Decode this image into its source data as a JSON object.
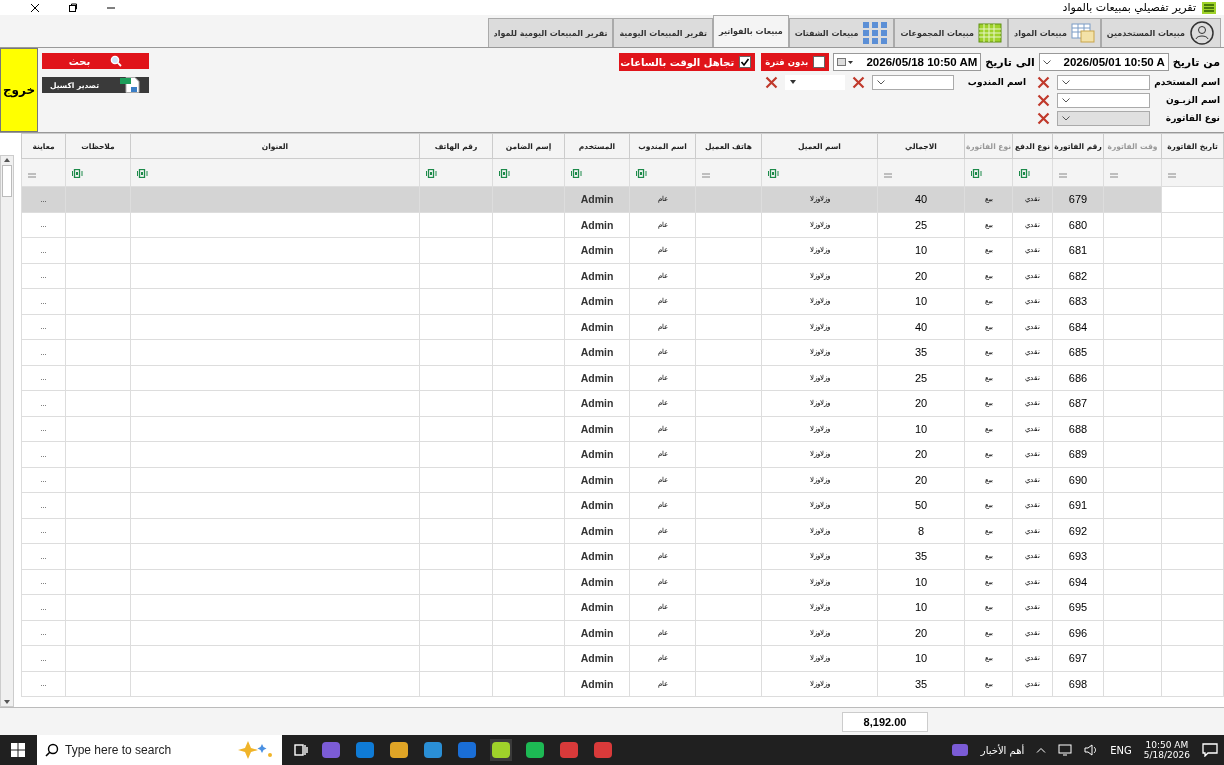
{
  "window": {
    "title": "تقرير تفصيلي بمبيعات بالمواد"
  },
  "tabs": [
    {
      "label": "مبيعات المستخدمين",
      "selected": false
    },
    {
      "label": "مبيعات المواد",
      "selected": false
    },
    {
      "label": "مبيعات المجموعات",
      "selected": false
    },
    {
      "label": "مبيعات الشفتات",
      "selected": false
    },
    {
      "label": "مبيعات بالفواتير",
      "selected": true
    },
    {
      "label": "تقرير المبيعات اليومية",
      "selected": false
    },
    {
      "label": "تقرير المبيعات اليومية للمواد",
      "selected": false
    }
  ],
  "filters": {
    "from_label": "من تاريخ",
    "from_value": "2026/05/01 10:50 A",
    "to_label": "الى تاريخ",
    "to_value": "2026/05/18 10:50 AM",
    "no_period": {
      "label": "بدون فترة",
      "checked": false
    },
    "ignore_time": {
      "label": "تجاهل الوقت بالساعات",
      "checked": true
    },
    "user": {
      "label": "اسم المستخدم",
      "disabled": false
    },
    "customer": {
      "label": "اسم الزبـون",
      "disabled": false
    },
    "invoice_type": {
      "label": "نوع الفاتورة",
      "disabled": true
    },
    "rep": {
      "label": "اسم المندوب",
      "disabled": false
    },
    "extra": {
      "disabled": false
    }
  },
  "buttons": {
    "search": "بحث",
    "export": "تصدير اكسيل",
    "exit": "خروج"
  },
  "table": {
    "columns": [
      {
        "label": "تاريخ الفاتورة",
        "dimmed": false,
        "kind": "equals"
      },
      {
        "label": "وقت الفاتورة",
        "dimmed": true,
        "kind": "equals"
      },
      {
        "label": "رقم الفاتورة",
        "dimmed": false,
        "kind": "equals"
      },
      {
        "label": "نوع الدفع",
        "dimmed": false,
        "kind": "funnel"
      },
      {
        "label": "نوع الفاتورة",
        "dimmed": true,
        "kind": "funnel"
      },
      {
        "label": "الاجمالي",
        "dimmed": false,
        "kind": "equals"
      },
      {
        "label": "اسم العميل",
        "dimmed": false,
        "kind": "funnel"
      },
      {
        "label": "هاتف العميل",
        "dimmed": false,
        "kind": "equals"
      },
      {
        "label": "اسم المندوب",
        "dimmed": false,
        "kind": "funnel"
      },
      {
        "label": "المستخدم",
        "dimmed": false,
        "kind": "funnel"
      },
      {
        "label": "إسم الضامن",
        "dimmed": false,
        "kind": "funnel"
      },
      {
        "label": "رقم الهاتف",
        "dimmed": false,
        "kind": "funnel"
      },
      {
        "label": "العنوان",
        "dimmed": false,
        "kind": "funnel"
      },
      {
        "label": "ملاحظات",
        "dimmed": false,
        "kind": "funnel"
      },
      {
        "label": "معاينة",
        "dimmed": false,
        "kind": "equals"
      }
    ],
    "rows": [
      {
        "invoice_no": "679",
        "payment": "نقدي",
        "type": "بيع",
        "total": "40",
        "customer": "وزلاوزلا",
        "rep": "عام",
        "user": "Admin",
        "view": "...",
        "selected": true
      },
      {
        "invoice_no": "680",
        "payment": "نقدي",
        "type": "بيع",
        "total": "25",
        "customer": "وزلاوزلا",
        "rep": "عام",
        "user": "Admin",
        "view": "...",
        "selected": false
      },
      {
        "invoice_no": "681",
        "payment": "نقدي",
        "type": "بيع",
        "total": "10",
        "customer": "وزلاوزلا",
        "rep": "عام",
        "user": "Admin",
        "view": "...",
        "selected": false
      },
      {
        "invoice_no": "682",
        "payment": "نقدي",
        "type": "بيع",
        "total": "20",
        "customer": "وزلاوزلا",
        "rep": "عام",
        "user": "Admin",
        "view": "...",
        "selected": false
      },
      {
        "invoice_no": "683",
        "payment": "نقدي",
        "type": "بيع",
        "total": "10",
        "customer": "وزلاوزلا",
        "rep": "عام",
        "user": "Admin",
        "view": "...",
        "selected": false
      },
      {
        "invoice_no": "684",
        "payment": "نقدي",
        "type": "بيع",
        "total": "40",
        "customer": "وزلاوزلا",
        "rep": "عام",
        "user": "Admin",
        "view": "...",
        "selected": false
      },
      {
        "invoice_no": "685",
        "payment": "نقدي",
        "type": "بيع",
        "total": "35",
        "customer": "وزلاوزلا",
        "rep": "عام",
        "user": "Admin",
        "view": "...",
        "selected": false
      },
      {
        "invoice_no": "686",
        "payment": "نقدي",
        "type": "بيع",
        "total": "25",
        "customer": "وزلاوزلا",
        "rep": "عام",
        "user": "Admin",
        "view": "...",
        "selected": false
      },
      {
        "invoice_no": "687",
        "payment": "نقدي",
        "type": "بيع",
        "total": "20",
        "customer": "وزلاوزلا",
        "rep": "عام",
        "user": "Admin",
        "view": "...",
        "selected": false
      },
      {
        "invoice_no": "688",
        "payment": "نقدي",
        "type": "بيع",
        "total": "10",
        "customer": "وزلاوزلا",
        "rep": "عام",
        "user": "Admin",
        "view": "...",
        "selected": false
      },
      {
        "invoice_no": "689",
        "payment": "نقدي",
        "type": "بيع",
        "total": "20",
        "customer": "وزلاوزلا",
        "rep": "عام",
        "user": "Admin",
        "view": "...",
        "selected": false
      },
      {
        "invoice_no": "690",
        "payment": "نقدي",
        "type": "بيع",
        "total": "20",
        "customer": "وزلاوزلا",
        "rep": "عام",
        "user": "Admin",
        "view": "...",
        "selected": false
      },
      {
        "invoice_no": "691",
        "payment": "نقدي",
        "type": "بيع",
        "total": "50",
        "customer": "وزلاوزلا",
        "rep": "عام",
        "user": "Admin",
        "view": "...",
        "selected": false
      },
      {
        "invoice_no": "692",
        "payment": "نقدي",
        "type": "بيع",
        "total": "8",
        "customer": "وزلاوزلا",
        "rep": "عام",
        "user": "Admin",
        "view": "...",
        "selected": false
      },
      {
        "invoice_no": "693",
        "payment": "نقدي",
        "type": "بيع",
        "total": "35",
        "customer": "وزلاوزلا",
        "rep": "عام",
        "user": "Admin",
        "view": "...",
        "selected": false
      },
      {
        "invoice_no": "694",
        "payment": "نقدي",
        "type": "بيع",
        "total": "10",
        "customer": "وزلاوزلا",
        "rep": "عام",
        "user": "Admin",
        "view": "...",
        "selected": false
      },
      {
        "invoice_no": "695",
        "payment": "نقدي",
        "type": "بيع",
        "total": "10",
        "customer": "وزلاوزلا",
        "rep": "عام",
        "user": "Admin",
        "view": "...",
        "selected": false
      },
      {
        "invoice_no": "696",
        "payment": "نقدي",
        "type": "بيع",
        "total": "20",
        "customer": "وزلاوزلا",
        "rep": "عام",
        "user": "Admin",
        "view": "...",
        "selected": false
      },
      {
        "invoice_no": "697",
        "payment": "نقدي",
        "type": "بيع",
        "total": "10",
        "customer": "وزلاوزلا",
        "rep": "عام",
        "user": "Admin",
        "view": "...",
        "selected": false
      },
      {
        "invoice_no": "698",
        "payment": "نقدي",
        "type": "بيع",
        "total": "35",
        "customer": "وزلاوزلا",
        "rep": "عام",
        "user": "Admin",
        "view": "...",
        "selected": false
      }
    ],
    "footer_total": "8,192.00"
  },
  "taskbar": {
    "search_placeholder": "Type here to search",
    "news": "أهم الأخبار",
    "language": "ENG",
    "time": "10:50 AM",
    "date": "5/18/2026"
  }
}
